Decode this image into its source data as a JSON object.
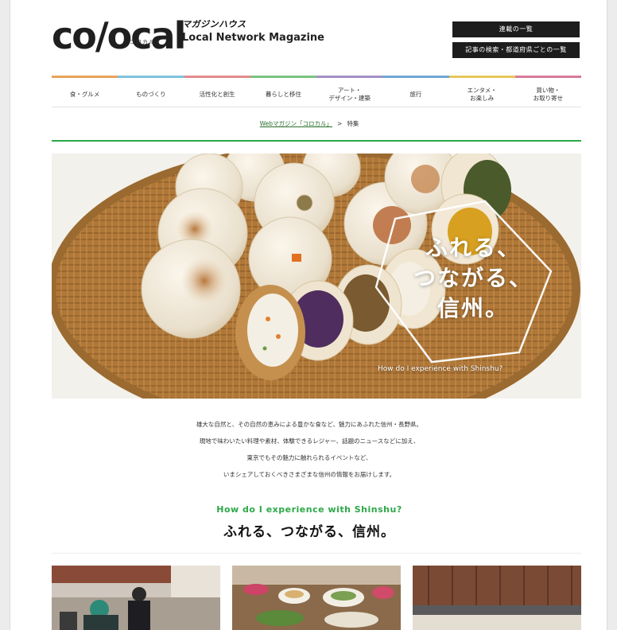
{
  "header": {
    "logo_text": "co/ocal",
    "logo_kana": "コロカル",
    "publisher": "マガジンハウス",
    "subtitle": "Local Network Magazine",
    "button_series": "連載の一覧",
    "button_search": "記事の検索・都道府県ごとの一覧"
  },
  "nav": [
    {
      "label": "食・グルメ",
      "color": "#e9a25a"
    },
    {
      "label": "ものづくり",
      "color": "#7fc2de"
    },
    {
      "label": "活性化と創生",
      "color": "#e48b8b"
    },
    {
      "label": "暮らしと移住",
      "color": "#7bc47f"
    },
    {
      "label": "アート・\nデザイン・建築",
      "color": "#a48fc7"
    },
    {
      "label": "旅行",
      "color": "#6ea7d8"
    },
    {
      "label": "エンタメ・\nお楽しみ",
      "color": "#e8c65a"
    },
    {
      "label": "買い物・\nお取り寄せ",
      "color": "#d87a9a"
    }
  ],
  "breadcrumb": {
    "home": "Webマガジン「コロカル」",
    "sep": ">",
    "current": "特集"
  },
  "hero": {
    "title_lines": [
      "ふれる、",
      "つながる、",
      "信州。"
    ],
    "subtitle": "How do I experience with Shinshu?"
  },
  "intro": [
    "雄大な自然と、その自然の恵みによる豊かな食など、魅力にあふれた信州・長野県。",
    "現地で味わいたい料理や素材、体験できるレジャー、話題のニュースなどに加え、",
    "東京でもその魅力に触れられるイベントなど、",
    "いまシェアしておくべきさまざまな信州の情報をお届けします。"
  ],
  "question": "How do I experience with Shinshu?",
  "tagline": "ふれる、つながる、信州。",
  "colors": {
    "accent_green": "#2ca847",
    "dark": "#1d1d1d"
  }
}
